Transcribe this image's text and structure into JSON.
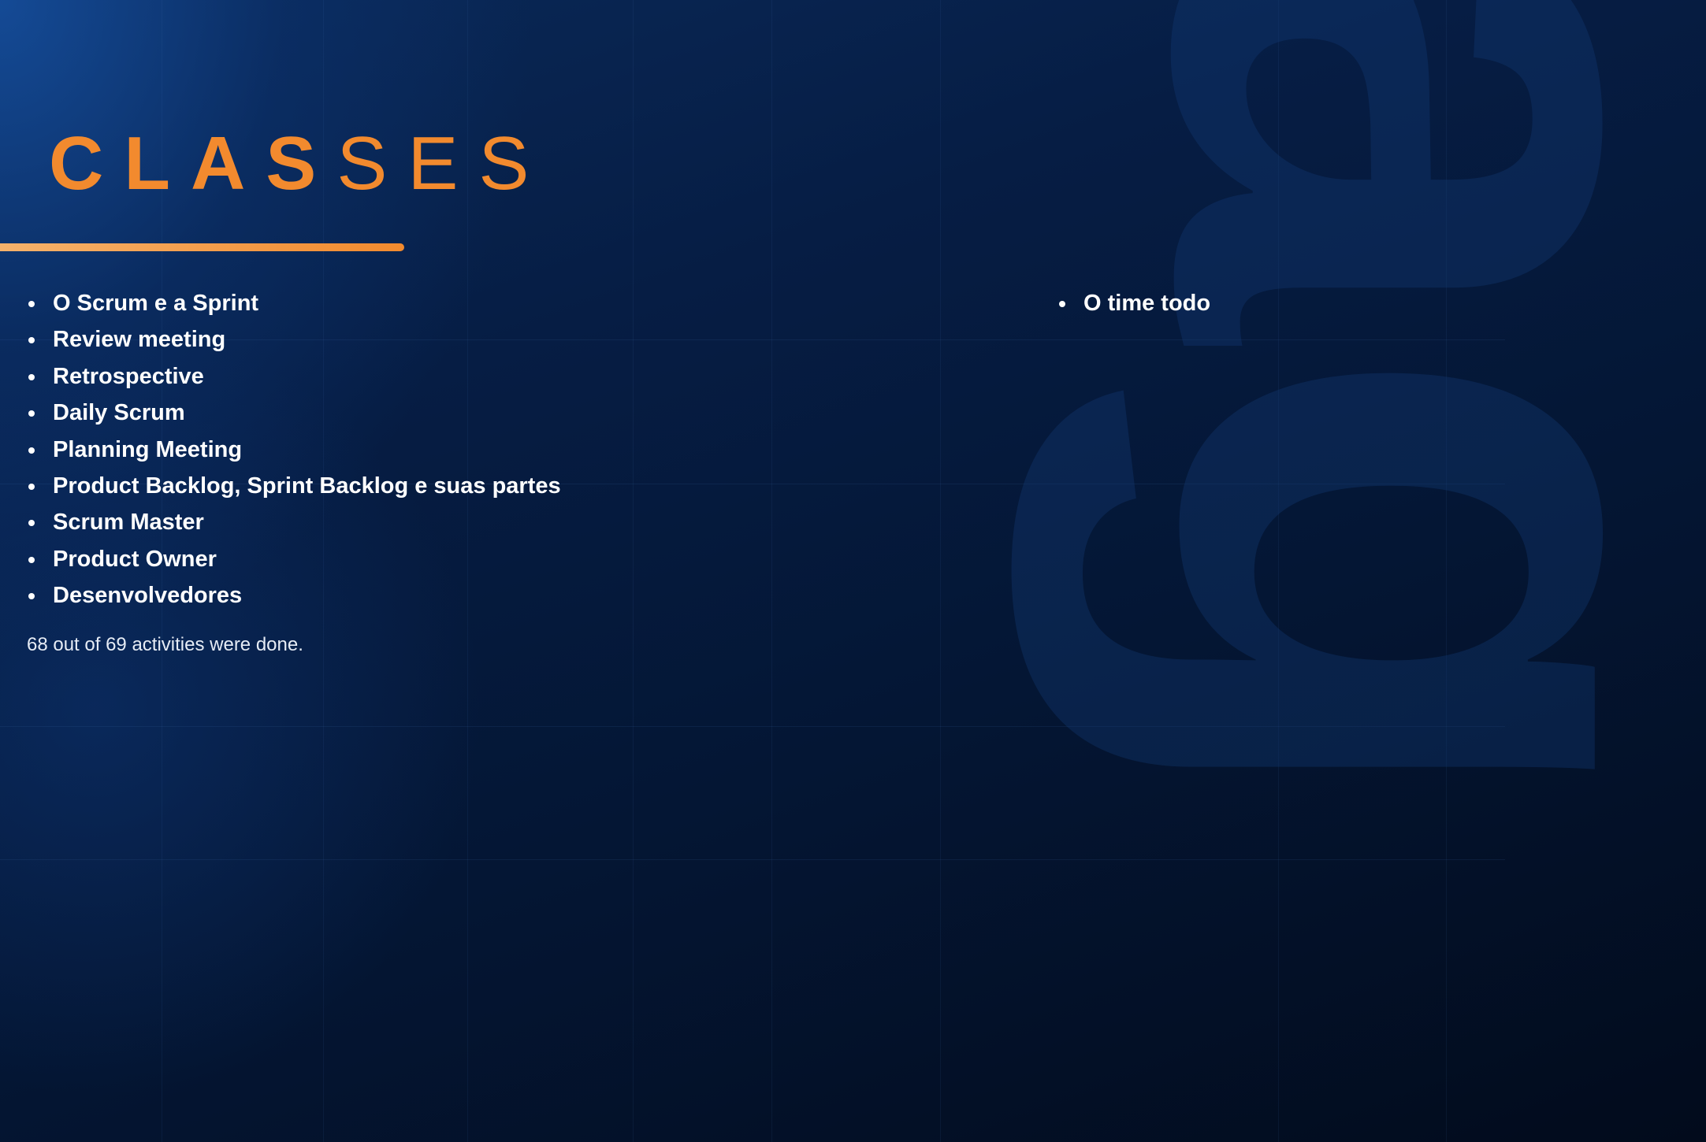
{
  "slide": {
    "title_bold": "CLAS",
    "title_light": "SES",
    "colors": {
      "accent": "#f28a2e",
      "background": "#04142b",
      "text": "#ffffff"
    }
  },
  "classes": {
    "left": [
      "O Scrum e a Sprint",
      "Review meeting",
      "Retrospective",
      "Daily Scrum",
      "Planning Meeting",
      "Product Backlog, Sprint Backlog e suas partes",
      "Scrum Master",
      "Product Owner",
      "Desenvolvedores"
    ],
    "right": [
      "O time todo"
    ]
  },
  "progress": {
    "text": "68 out of 69 activities were done.",
    "done": 68,
    "total": 69
  }
}
